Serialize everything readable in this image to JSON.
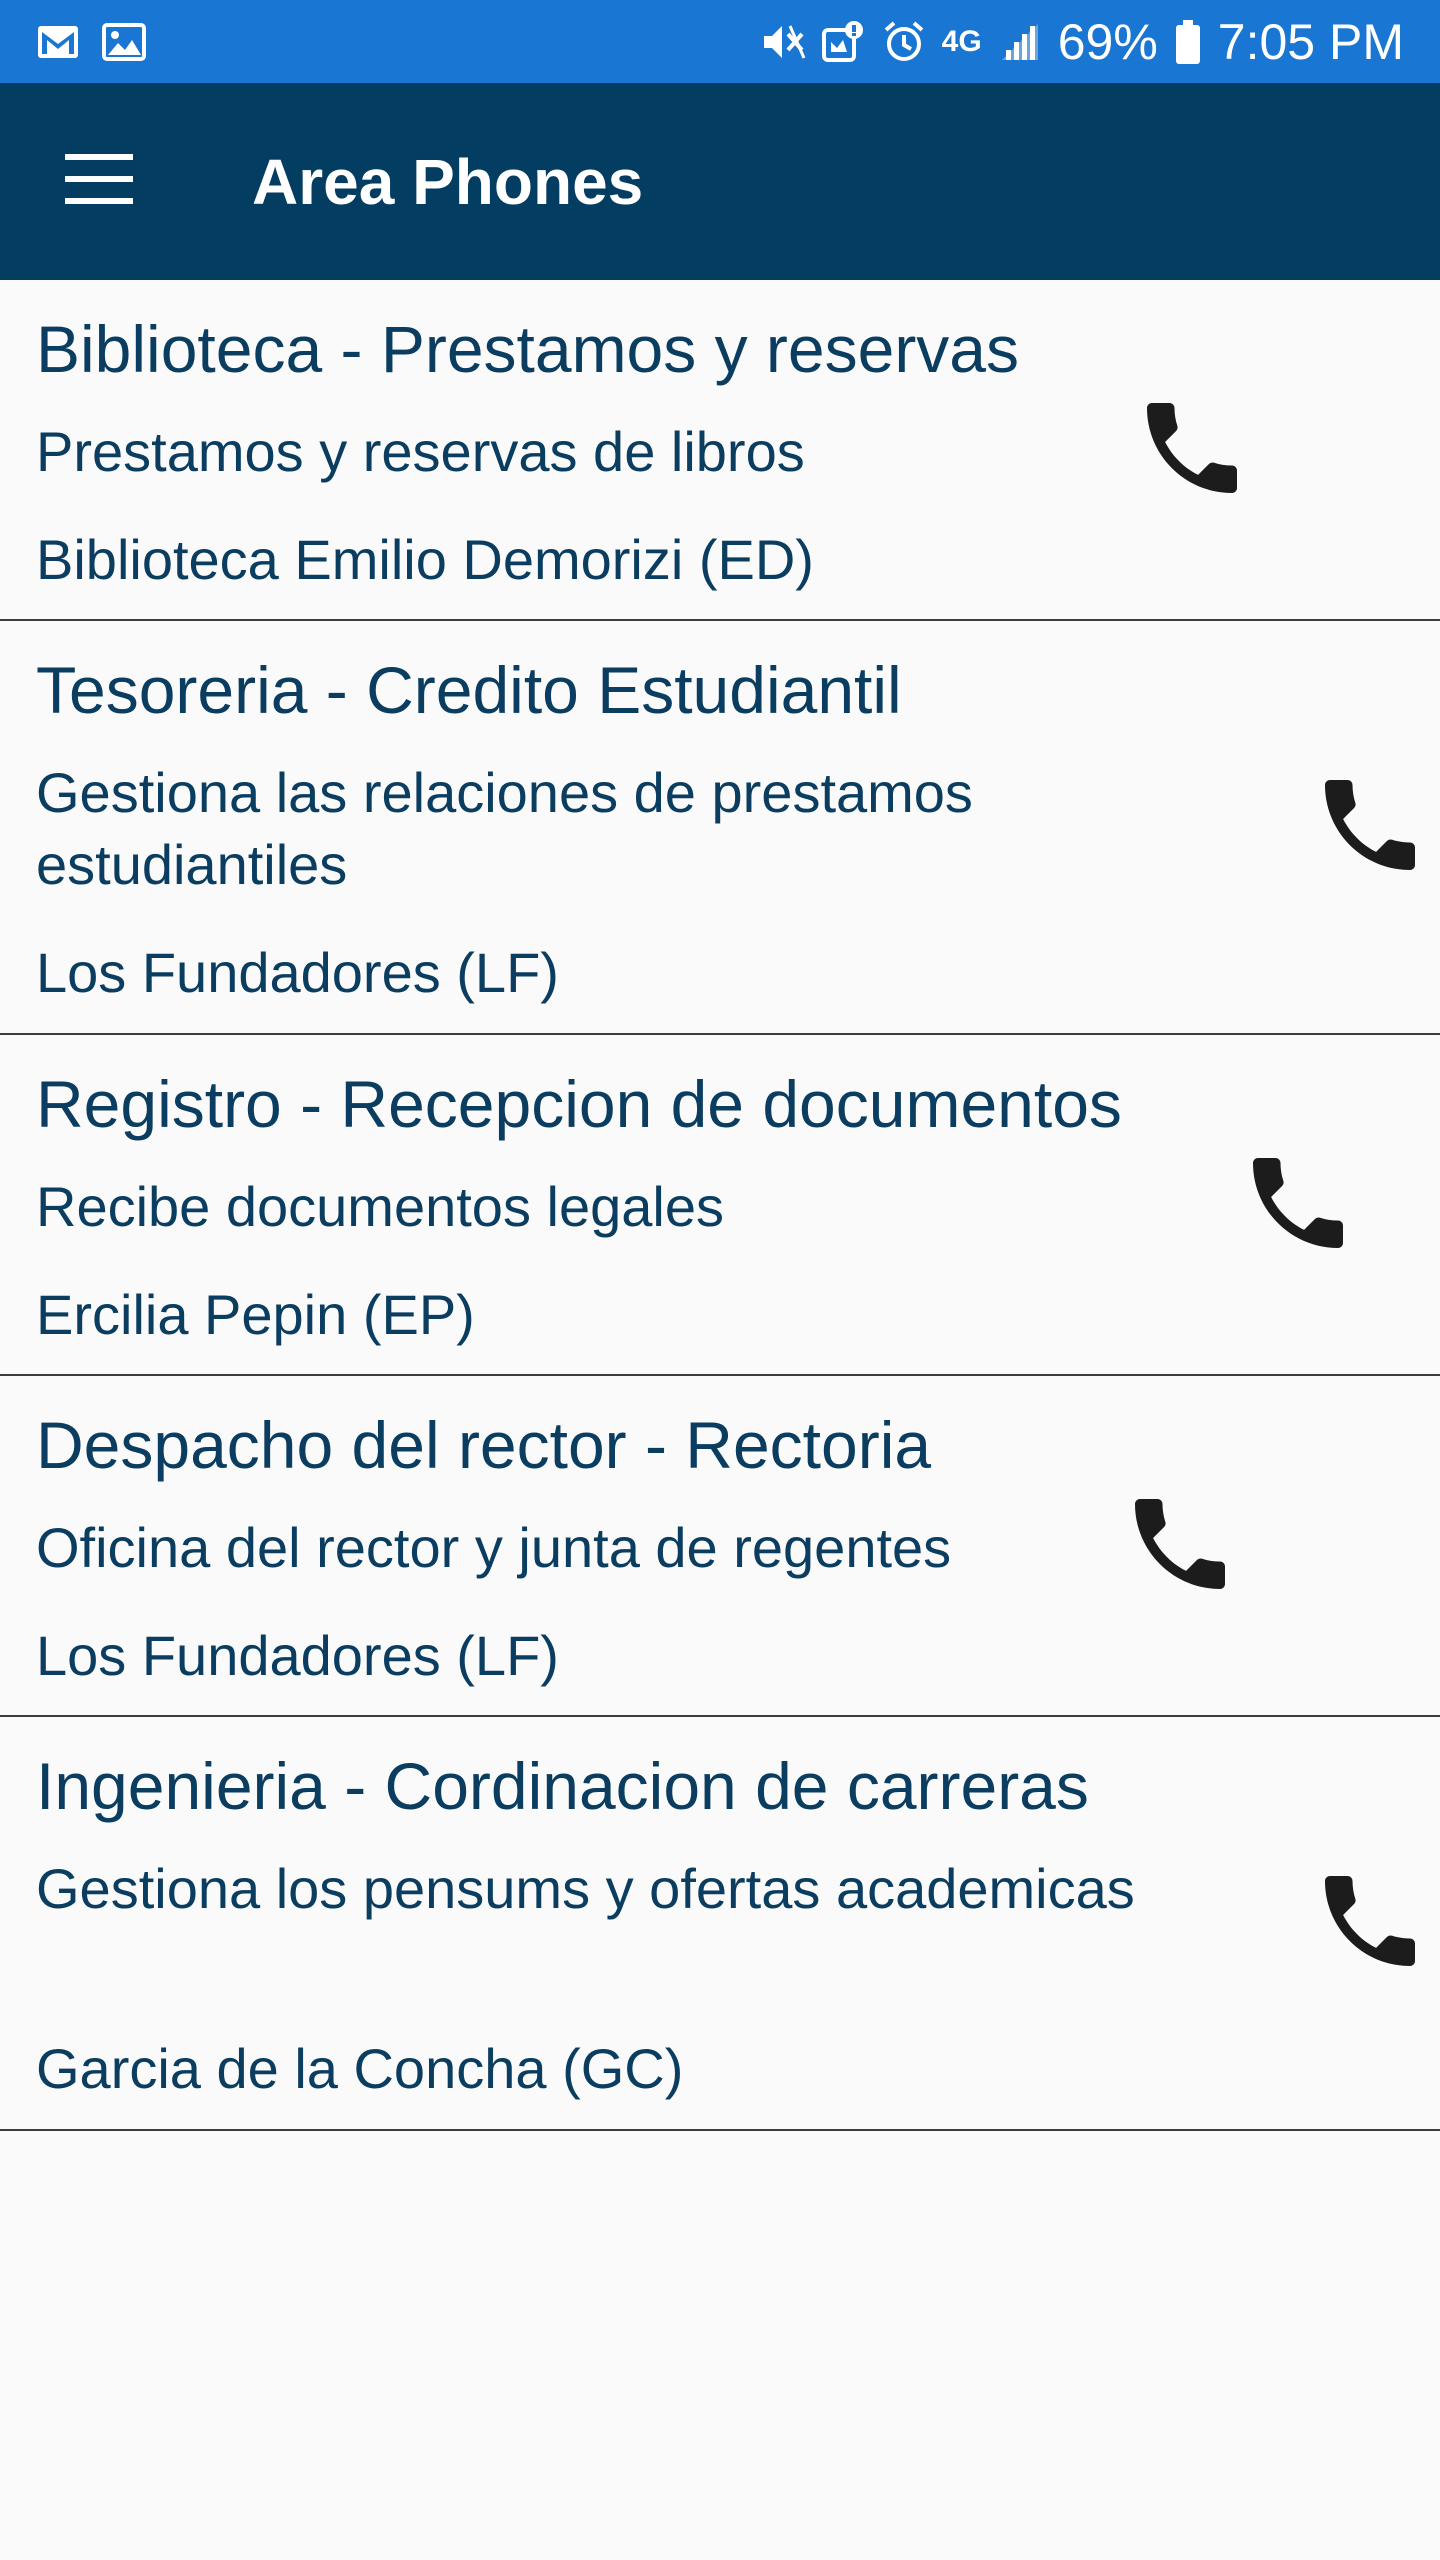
{
  "status_bar": {
    "battery": "69%",
    "time": "7:05 PM",
    "network": "4G",
    "left_icons": [
      "mail-icon",
      "image-icon"
    ],
    "right_icons": [
      "mute-icon",
      "app-notification-icon",
      "alarm-icon",
      "lte-icon",
      "signal-icon",
      "battery-icon"
    ]
  },
  "app_bar": {
    "title": "Area Phones",
    "menu_icon": "menu-icon"
  },
  "items": [
    {
      "title": "Biblioteca - Prestamos y reservas",
      "description": "Prestamos y reservas de libros",
      "location": "Biblioteca Emilio Demorizi (ED)",
      "icon": "phone-icon"
    },
    {
      "title": "Tesoreria - Credito Estudiantil",
      "description": "Gestiona las relaciones de prestamos estudiantiles",
      "location": "Los Fundadores (LF)",
      "icon": "phone-icon"
    },
    {
      "title": "Registro - Recepcion de documentos",
      "description": "Recibe documentos legales",
      "location": "Ercilia Pepin (EP)",
      "icon": "phone-icon"
    },
    {
      "title": "Despacho del rector - Rectoria",
      "description": "Oficina del rector y junta de regentes",
      "location": "Los Fundadores (LF)",
      "icon": "phone-icon"
    },
    {
      "title": "Ingenieria - Cordinacion de carreras",
      "description": "Gestiona los pensums y ofertas academicas",
      "location": "Garcia de la Concha (GC)",
      "icon": "phone-icon"
    }
  ],
  "colors": {
    "status_bar": "#1976d2",
    "app_bar": "#033d62",
    "text": "#0a3d60",
    "background": "#fafafa"
  }
}
